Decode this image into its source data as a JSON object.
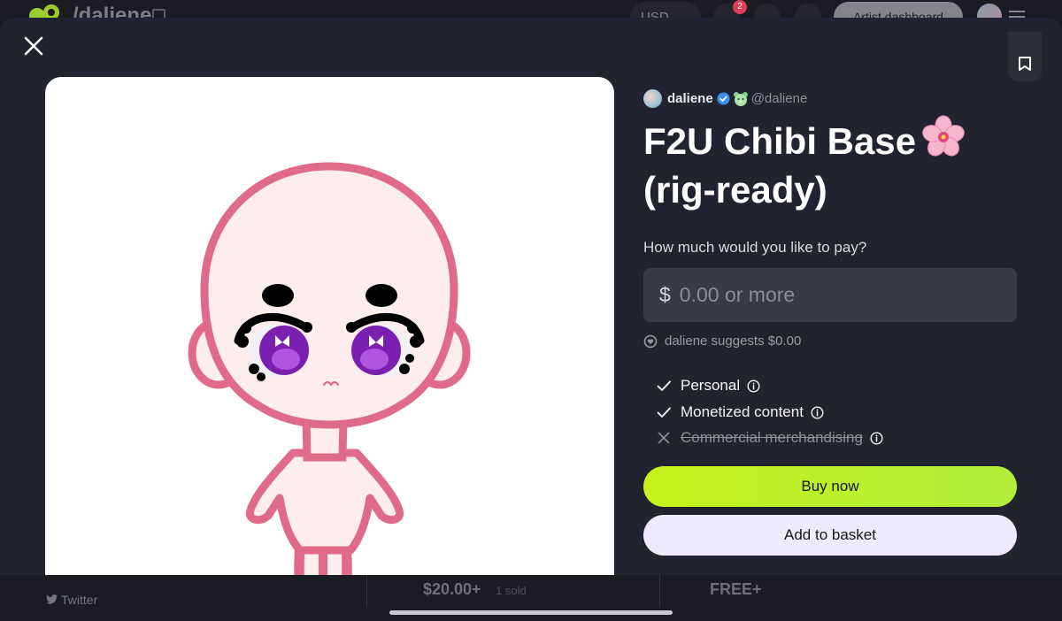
{
  "background": {
    "handle": "/daliene",
    "currency": "USD",
    "notification_count": "2",
    "artist_dashboard": "Artist dashboard",
    "twitter_link": "Twitter",
    "price_card_1": "$20.00+",
    "price_card_1_sold": "1 sold",
    "price_card_2": "FREE+"
  },
  "product": {
    "creator_name": "daliene",
    "creator_handle": "@daliene",
    "title": "F2U Chibi Base",
    "title_line2": "(rig-ready)",
    "pay_question": "How much would you like to pay?",
    "currency_symbol": "$",
    "price_placeholder": "0.00 or more",
    "suggestion": "daliene suggests $0.00"
  },
  "licenses": [
    {
      "label": "Personal",
      "included": true
    },
    {
      "label": "Monetized content",
      "included": true
    },
    {
      "label": "Commercial merchandising",
      "included": false
    }
  ],
  "actions": {
    "buy_now": "Buy now",
    "add_to_basket": "Add to basket"
  },
  "colors": {
    "accent_buy": "#c6f21a",
    "basket_bg": "#efeafc",
    "modal_bg": "#222330",
    "chibi_outline": "#e06a8a",
    "chibi_skin": "#fdeeed",
    "eye_purple": "#7b1fb0"
  },
  "icons": {
    "close": "close-icon",
    "bookmark": "bookmark-icon",
    "verified": "verified-badge-icon",
    "suggest": "heart-bubble-icon",
    "check": "check-icon",
    "cross": "x-icon",
    "info": "info-icon",
    "flower": "cherry-blossom-emoji"
  }
}
